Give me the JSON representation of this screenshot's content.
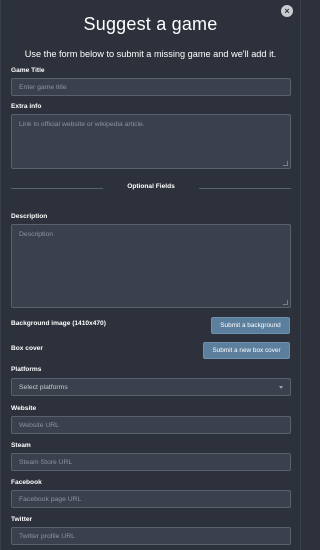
{
  "modal": {
    "title": "Suggest a game",
    "subtitle": "Use the form below to submit a missing game and we'll add it.",
    "close_icon": "×"
  },
  "fields": {
    "game_title": {
      "label": "Game Title",
      "placeholder": "Enter game title"
    },
    "extra_info": {
      "label": "Extra info",
      "placeholder": "Link to official website or wikipedia article."
    },
    "optional_divider": "Optional Fields",
    "description": {
      "label": "Description",
      "placeholder": "Description"
    },
    "background": {
      "label": "Background image (1410x470)",
      "button": "Submit a background"
    },
    "box_cover": {
      "label": "Box cover",
      "button": "Submit a new box cover"
    },
    "platforms": {
      "label": "Platforms",
      "selected": "Select platforms"
    },
    "website": {
      "label": "Website",
      "placeholder": "Website URL"
    },
    "steam": {
      "label": "Steam",
      "placeholder": "Steam Store URL"
    },
    "facebook": {
      "label": "Facebook",
      "placeholder": "Facebook page URL"
    },
    "twitter": {
      "label": "Twitter",
      "placeholder": "Twitter profile URL"
    }
  },
  "colors": {
    "background": "#2c313b",
    "input_bg": "#3a404c",
    "input_border": "#5a616e",
    "button_bg": "#5b7f9d"
  }
}
